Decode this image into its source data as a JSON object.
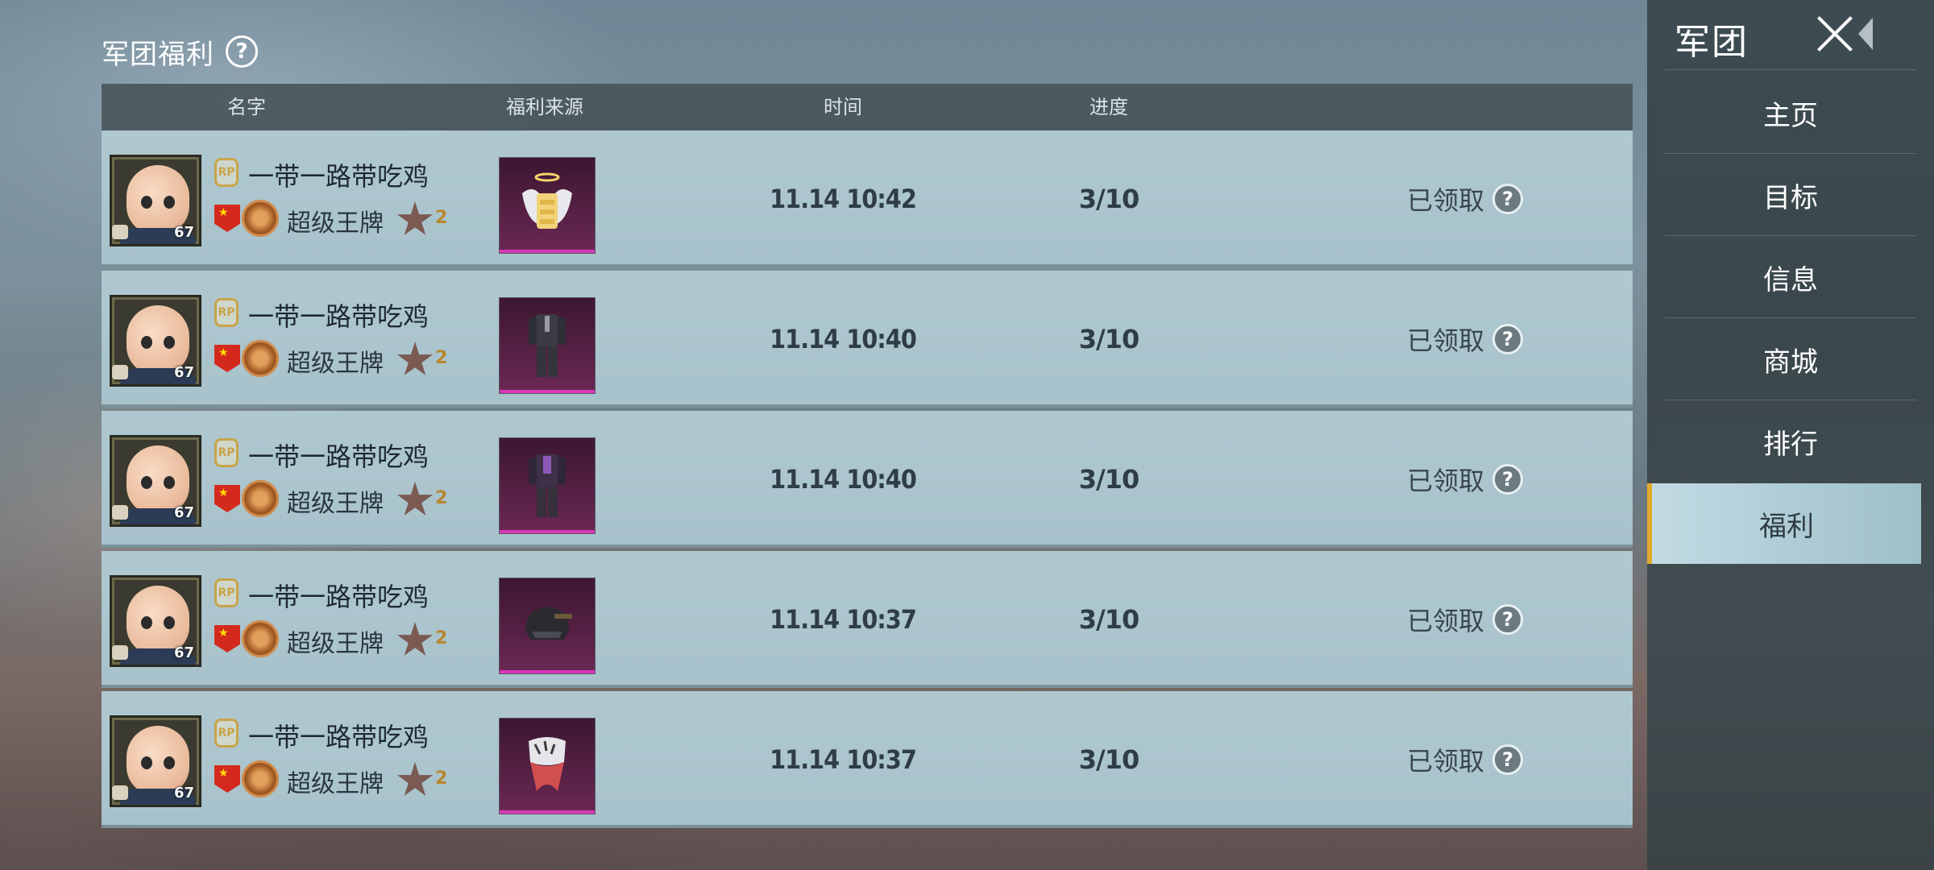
{
  "header": {
    "title": "军团福利",
    "help_icon": "?"
  },
  "table": {
    "columns": [
      "名字",
      "福利来源",
      "时间",
      "进度"
    ],
    "rows": [
      {
        "name": "一带一路带吃鸡",
        "level": "67",
        "rp_badge": "RP",
        "rank": "超级王牌",
        "rank_stars": "2",
        "source_item": "angel-wings-chest",
        "time": "11.14  10:42",
        "progress": "3/10",
        "status": "已领取"
      },
      {
        "name": "一带一路带吃鸡",
        "level": "67",
        "rp_badge": "RP",
        "rank": "超级王牌",
        "rank_stars": "2",
        "source_item": "dark-suit-outfit",
        "time": "11.14  10:40",
        "progress": "3/10",
        "status": "已领取"
      },
      {
        "name": "一带一路带吃鸡",
        "level": "67",
        "rp_badge": "RP",
        "rank": "超级王牌",
        "rank_stars": "2",
        "source_item": "purple-suit-outfit",
        "time": "11.14  10:40",
        "progress": "3/10",
        "status": "已领取"
      },
      {
        "name": "一带一路带吃鸡",
        "level": "67",
        "rp_badge": "RP",
        "rank": "超级王牌",
        "rank_stars": "2",
        "source_item": "black-helmet",
        "time": "11.14  10:37",
        "progress": "3/10",
        "status": "已领取"
      },
      {
        "name": "一带一路带吃鸡",
        "level": "67",
        "rp_badge": "RP",
        "rank": "超级王牌",
        "rank_stars": "2",
        "source_item": "tiger-mask",
        "time": "11.14  10:37",
        "progress": "3/10",
        "status": "已领取"
      }
    ]
  },
  "sidebar": {
    "title": "军团",
    "items": [
      {
        "label": "主页",
        "active": false
      },
      {
        "label": "目标",
        "active": false
      },
      {
        "label": "信息",
        "active": false
      },
      {
        "label": "商城",
        "active": false
      },
      {
        "label": "排行",
        "active": false
      },
      {
        "label": "福利",
        "active": true
      }
    ]
  },
  "colors": {
    "accent": "#e5a92a",
    "row_bg": "#afc8d0",
    "item_border": "#d838b8",
    "sidebar_bg": "#3d4c52"
  }
}
